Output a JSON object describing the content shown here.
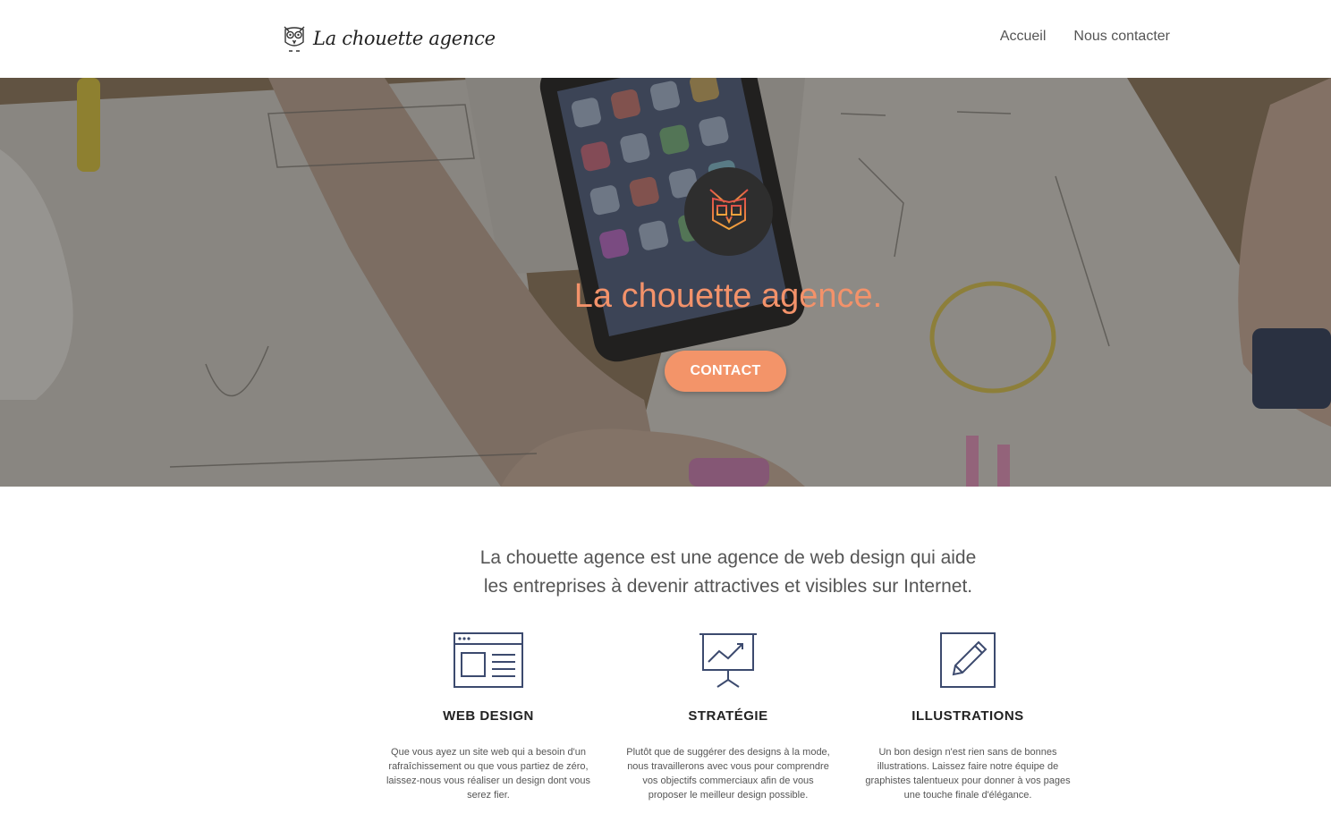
{
  "header": {
    "logo_text": "La chouette agence",
    "logo_icon": "owl-logo-icon",
    "nav": [
      {
        "label": "Accueil"
      },
      {
        "label": "Nous contacter"
      }
    ]
  },
  "hero": {
    "badge_icon": "owl-badge-icon",
    "title": "La chouette agence.",
    "cta_label": "CONTACT"
  },
  "intro": {
    "line1": "La chouette agence est une agence de web design qui aide",
    "line2": "les entreprises à devenir attractives et visibles sur Internet."
  },
  "services": [
    {
      "icon": "web-design-icon",
      "title": "WEB DESIGN",
      "text": "Que vous ayez un site web qui a besoin d'un rafraîchissement ou que vous partiez de zéro, laissez-nous vous réaliser un design dont vous serez fier."
    },
    {
      "icon": "strategy-chart-icon",
      "title": "STRATÉGIE",
      "text": "Plutôt que de suggérer des designs à la mode, nous travaillerons avec vous pour comprendre vos objectifs commerciaux afin de vous proposer le meilleur design possible."
    },
    {
      "icon": "pencil-illustration-icon",
      "title": "ILLUSTRATIONS",
      "text": "Un bon design n'est rien sans de bonnes illustrations. Laissez faire notre équipe de graphistes talentueux pour donner à vos pages une touche finale d'élégance."
    }
  ],
  "colors": {
    "accent": "#f39469",
    "icon_stroke": "#3c4a6e",
    "hero_badge": "#2e2e2e"
  }
}
